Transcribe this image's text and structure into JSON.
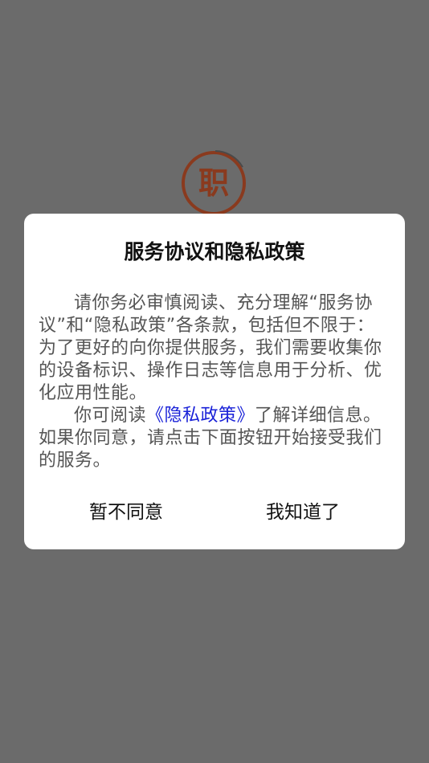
{
  "splash": {
    "logo_char": "职"
  },
  "dialog": {
    "title": "服务协议和隐私政策",
    "paragraph1": "请你务必审慎阅读、充分理解“服务协议”和“隐私政策”各条款，包括但不限于：为了更好的向你提供服务，我们需要收集你的设备标识、操作日志等信息用于分析、优化应用性能。",
    "paragraph2_before": "你可阅读",
    "privacy_link": "《隐私政策》",
    "paragraph2_after": "了解详细信息。如果你同意，请点击下面按钮开始接受我们的服务。",
    "disagree_label": "暂不同意",
    "agree_label": "我知道了"
  },
  "colors": {
    "overlay": "#6b6b6b",
    "dialog_bg": "#ffffff",
    "link": "#1a22d8",
    "logo": "#8a3a1e"
  }
}
